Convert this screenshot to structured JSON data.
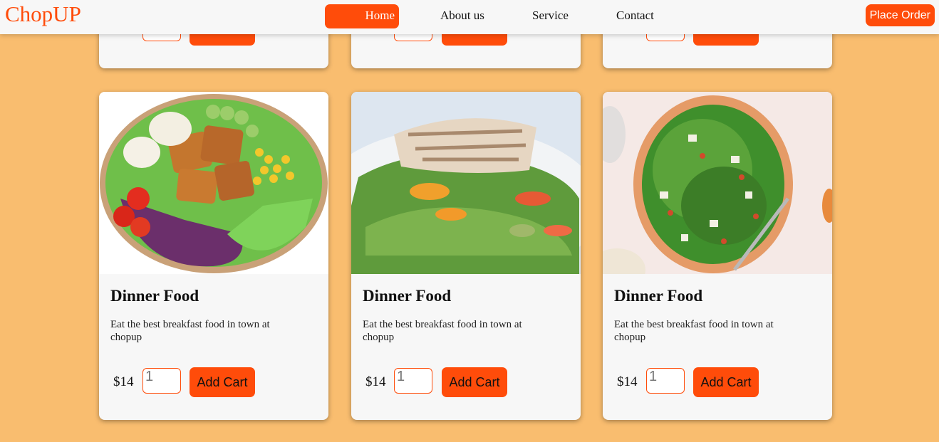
{
  "brand": {
    "logo": "ChopUP"
  },
  "nav": {
    "items": [
      "Home",
      "About us",
      "Service",
      "Contact"
    ],
    "place_order": "Place Order"
  },
  "colors": {
    "accent": "#ff4c0a",
    "page_bg": "#f9bd6f",
    "card_bg": "#f7f7f7"
  },
  "cards": [
    {
      "title": "Dinner Food",
      "description": "Eat the best breakfast food in town at chopup",
      "price": "$14",
      "qty": "1",
      "add_label": "Add Cart"
    },
    {
      "title": "Dinner Food",
      "description": "Eat the best breakfast food in town at chopup",
      "price": "$14",
      "qty": "1",
      "add_label": "Add Cart"
    },
    {
      "title": "Dinner Food",
      "description": "Eat the best breakfast food in town at chopup",
      "price": "$14",
      "qty": "1",
      "add_label": "Add Cart"
    }
  ]
}
